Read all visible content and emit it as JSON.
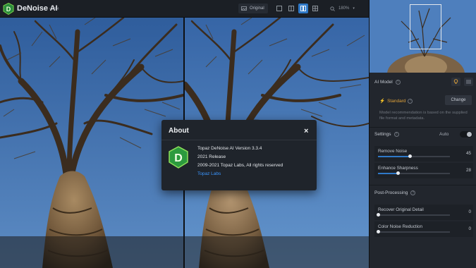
{
  "app": {
    "name": "DeNoise AI",
    "version": "v3.3.4"
  },
  "toolbar": {
    "original_label": "Original",
    "zoom_label": "180%"
  },
  "panel": {
    "ai_model_title": "AI Model",
    "model_name": "Standard",
    "change_label": "Change",
    "model_note": "Model recommendation is based on the supplied file format and metadata.",
    "settings_title": "Settings",
    "auto_label": "Auto",
    "sliders": [
      {
        "label": "Remove Noise",
        "value": "45",
        "fraction": 0.45
      },
      {
        "label": "Enhance Sharpness",
        "value": "28",
        "fraction": 0.28
      }
    ],
    "post_title": "Post-Processing",
    "post_sliders": [
      {
        "label": "Recover Original Detail",
        "value": "0",
        "fraction": 0
      },
      {
        "label": "Color Noise Reduction",
        "value": "0",
        "fraction": 0
      }
    ]
  },
  "dialog": {
    "title": "About",
    "close_symbol": "×",
    "line1": "Topaz DeNoise AI Version 3.3.4",
    "line2": "2021 Release",
    "line3": "2009-2021 Topaz Labs, All rights reserved",
    "link": "Topaz Labs"
  },
  "colors": {
    "accent": "#2f79c8",
    "model_highlight": "#e0a23a",
    "link": "#3a96ff"
  }
}
